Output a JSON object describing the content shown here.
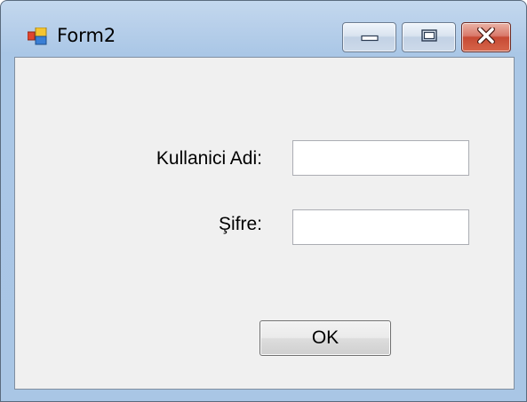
{
  "window": {
    "title": "Form2",
    "icon": "winforms-app-icon",
    "caption_buttons": {
      "minimize": "minimize-icon",
      "maximize": "maximize-icon",
      "close": "close-icon"
    },
    "colors": {
      "frame": "#b7cfea",
      "client_background": "#f0f0f0",
      "close_button": "#c64a34"
    }
  },
  "form": {
    "username_label": "Kullanici Adi:",
    "username_value": "",
    "password_label": "Şifre:",
    "password_value": "",
    "ok_label": "OK"
  }
}
